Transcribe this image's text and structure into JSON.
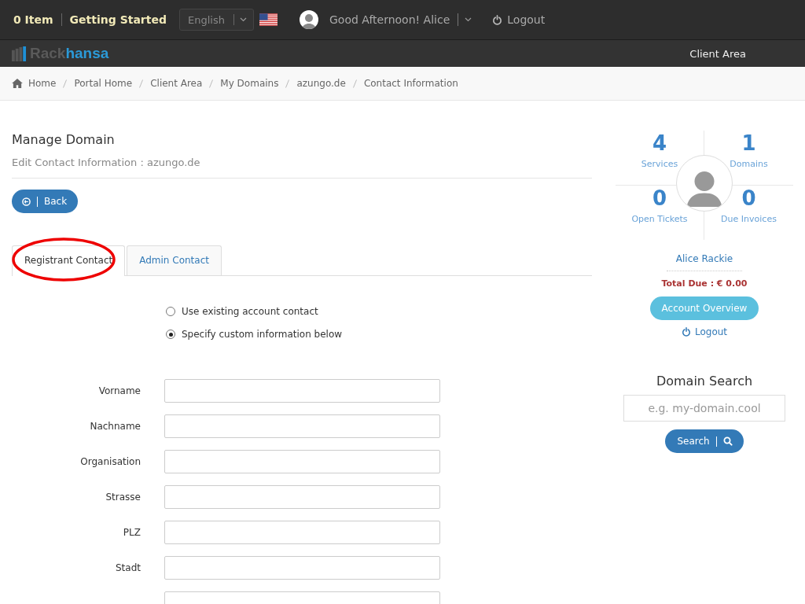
{
  "top_bar": {
    "cart": "0 Item",
    "getting_started": "Getting Started",
    "language": {
      "value": "English"
    },
    "greeting": "Good Afternoon! Alice",
    "logout": "Logout"
  },
  "brand": {
    "part_1": "Rack",
    "part_2": "hansa"
  },
  "nav": [
    {
      "label": "Client Area"
    }
  ],
  "breadcrumb": [
    {
      "label": "Home",
      "kind": "home"
    },
    {
      "label": "Portal Home"
    },
    {
      "label": "Client Area"
    },
    {
      "label": "My Domains"
    },
    {
      "label": "azungo.de"
    },
    {
      "label": "Contact Information"
    }
  ],
  "heading": "Manage Domain",
  "subheading": "Edit Contact Information : azungo.de",
  "back_button": "Back",
  "tabs": [
    {
      "label": "Registrant Contact",
      "selected": true,
      "annotated": true
    },
    {
      "label": "Admin Contact",
      "selected": false,
      "annotated": false
    }
  ],
  "contact_options": [
    {
      "label": "Use existing account contact",
      "selected": false
    },
    {
      "label": "Specify custom information below",
      "selected": true
    }
  ],
  "fields": [
    {
      "label": "Vorname",
      "kind": "text"
    },
    {
      "label": "Nachname",
      "kind": "text"
    },
    {
      "label": "Organisation",
      "kind": "text"
    },
    {
      "label": "Strasse",
      "kind": "text"
    },
    {
      "label": "PLZ",
      "kind": "text"
    },
    {
      "label": "Stadt",
      "kind": "text"
    },
    {
      "kind": "text"
    }
  ],
  "stats": [
    {
      "value": "4",
      "label": "Services"
    },
    {
      "value": "1",
      "label": "Domains"
    },
    {
      "value": "0",
      "label": "Open Tickets"
    },
    {
      "value": "0",
      "label": "Due Invoices"
    }
  ],
  "client": {
    "name": "Alice Rackie",
    "total_due": "Total Due : € 0.00",
    "overview_button": "Account Overview",
    "logout": "Logout"
  },
  "domain_search": {
    "title": "Domain Search",
    "placeholder": "e.g. my-domain.cool",
    "button": "Search"
  }
}
